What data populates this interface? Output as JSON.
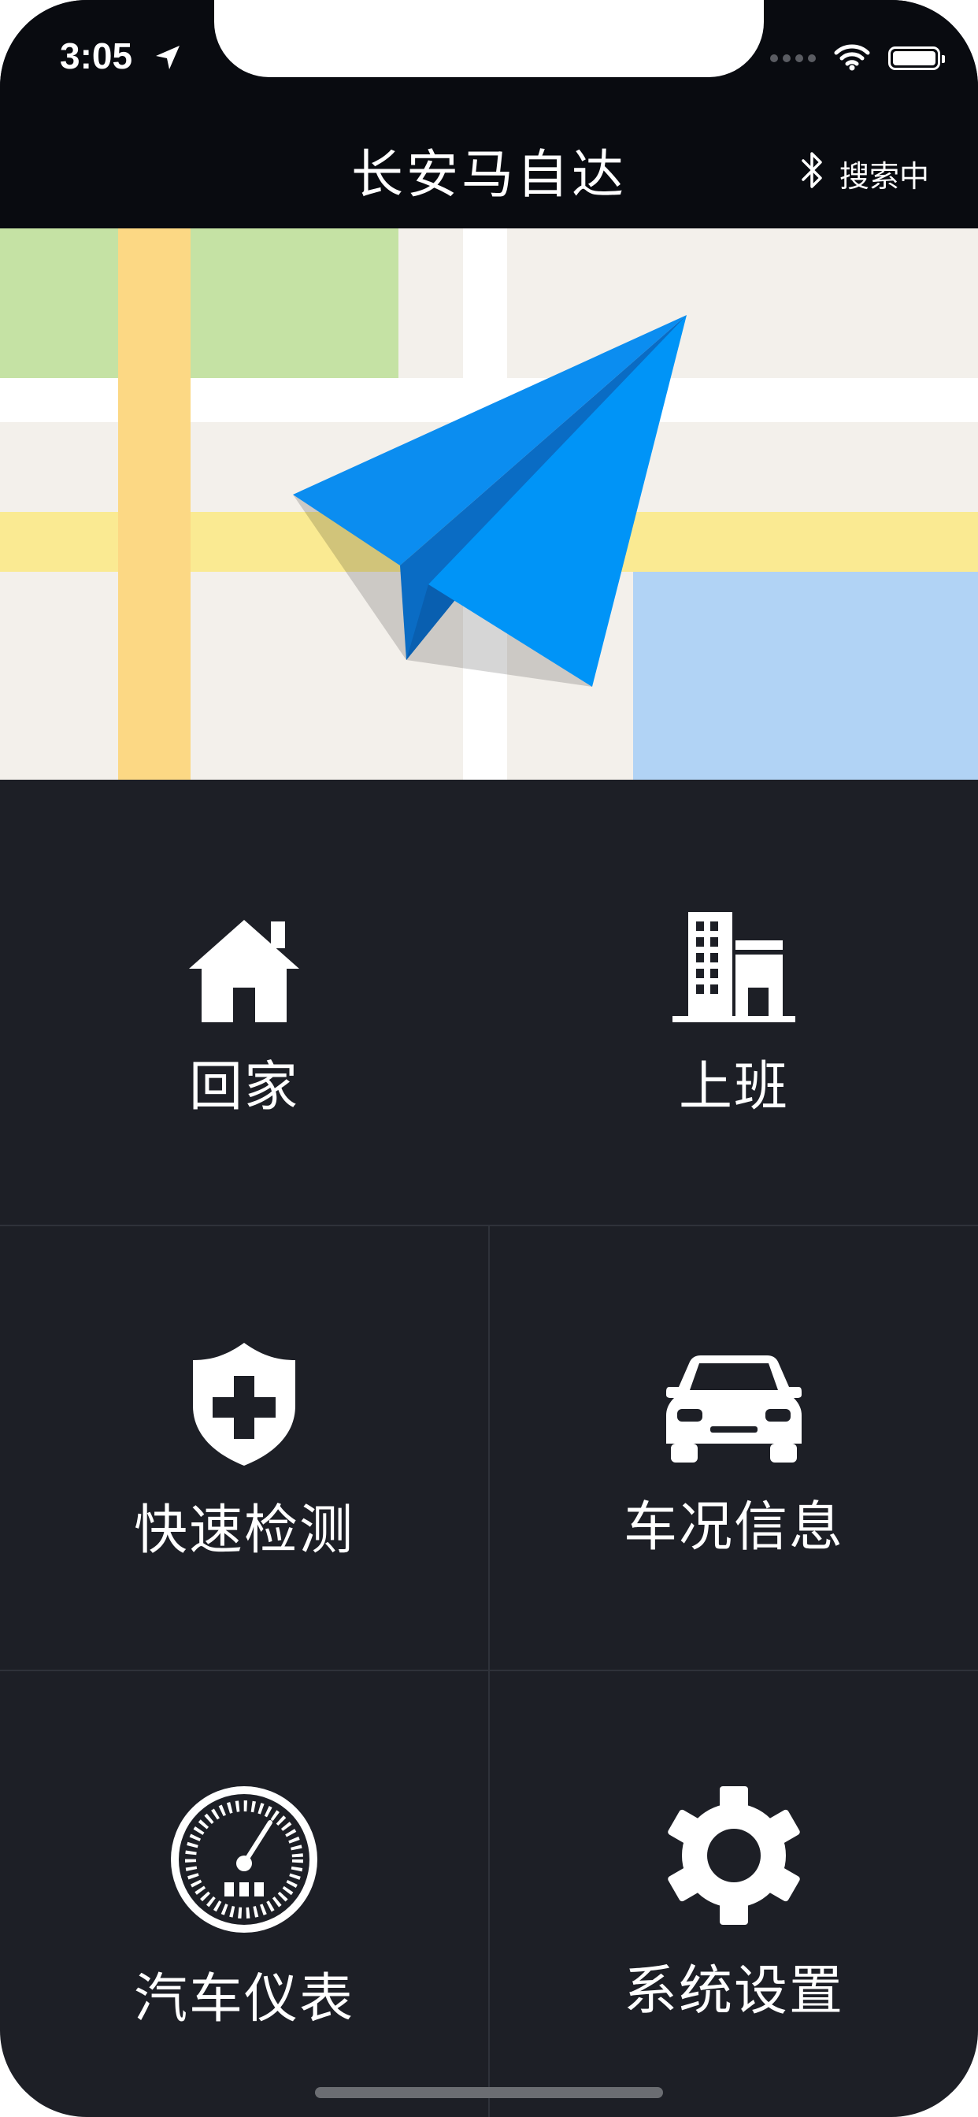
{
  "status_bar": {
    "time": "3:05",
    "icons": [
      "location-arrow-icon",
      "cellular-signal-icon",
      "wifi-icon",
      "battery-icon"
    ]
  },
  "header": {
    "title": "长安马自达",
    "bluetooth": {
      "icon": "bluetooth-icon",
      "status": "搜索中"
    }
  },
  "map": {
    "icon": "paper-plane-navigation-icon",
    "colors": {
      "background": "#f3f0eb",
      "park": "#c5e2a4",
      "main_road": "#fcd884",
      "minor_road": "#faea92",
      "water": "#b1d3f5",
      "plane": "#0091f5"
    }
  },
  "menu": [
    {
      "id": "home",
      "label": "回家",
      "icon": "home-icon"
    },
    {
      "id": "work",
      "label": "上班",
      "icon": "office-building-icon"
    },
    {
      "id": "quick-check",
      "label": "快速检测",
      "icon": "shield-plus-icon"
    },
    {
      "id": "vehicle-info",
      "label": "车况信息",
      "icon": "car-icon"
    },
    {
      "id": "dashboard",
      "label": "汽车仪表",
      "icon": "speedometer-icon"
    },
    {
      "id": "settings",
      "label": "系统设置",
      "icon": "gear-icon"
    }
  ],
  "colors": {
    "header_bg": "#090b10",
    "panel_bg": "#1d1f26",
    "divider": "#2f323a",
    "text": "#ffffff"
  }
}
